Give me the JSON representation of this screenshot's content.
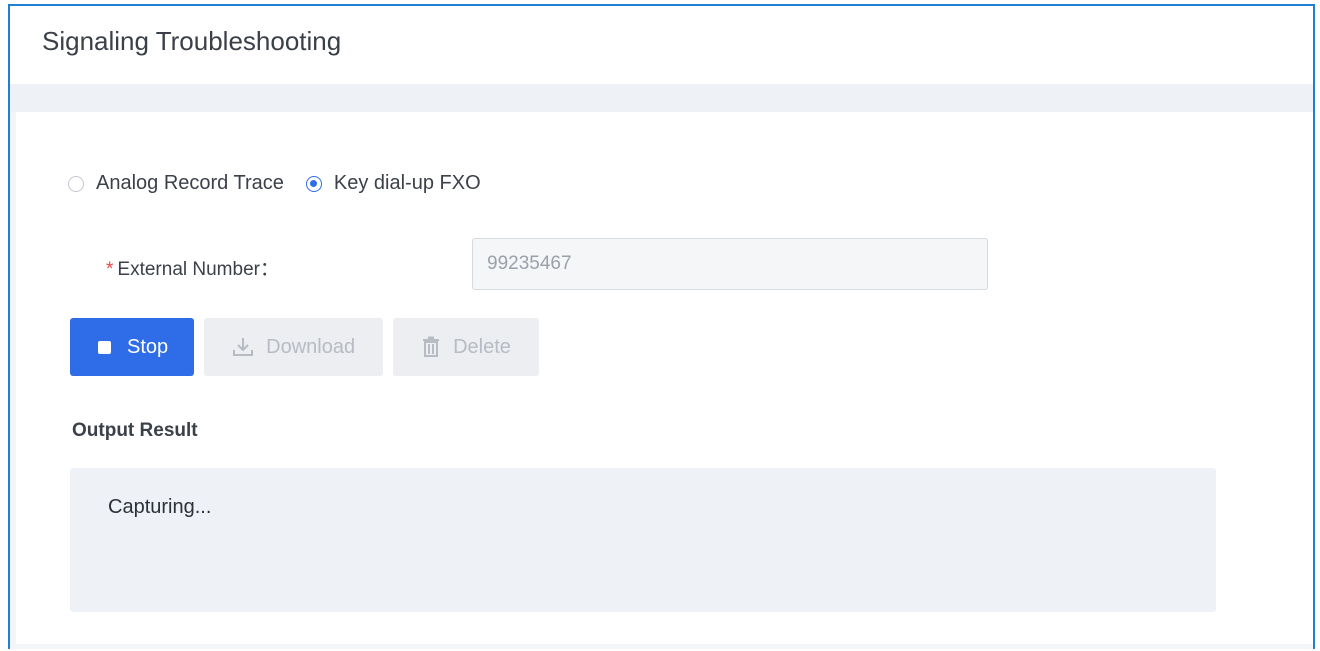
{
  "header": {
    "title": "Signaling Troubleshooting"
  },
  "radio_group": {
    "options": [
      {
        "label": "Analog Record Trace",
        "checked": false
      },
      {
        "label": "Key dial-up FXO",
        "checked": true
      }
    ]
  },
  "external_number": {
    "label": "External Number：",
    "required_mark": "*",
    "value": "99235467"
  },
  "buttons": {
    "stop": "Stop",
    "download": "Download",
    "delete": "Delete"
  },
  "output": {
    "title": "Output Result",
    "text": "Capturing..."
  },
  "colors": {
    "accent": "#2f6de8",
    "frame_border": "#1e7fd6",
    "required": "#e5484d"
  }
}
